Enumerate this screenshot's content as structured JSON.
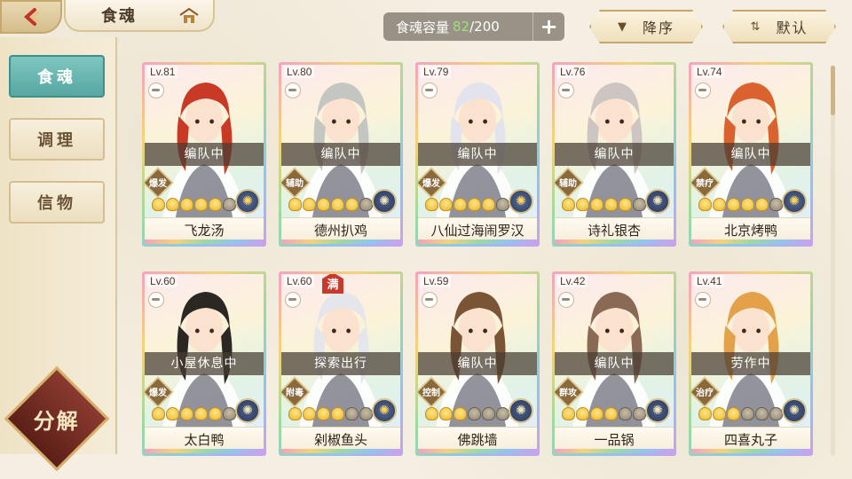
{
  "header": {
    "title": "食魂",
    "capacity_label": "食魂容量",
    "capacity_current": "82",
    "capacity_max": "/200",
    "plus_label": "+",
    "sort_order_label": "降序",
    "sort_mode_label": "默认"
  },
  "sidebar": {
    "items": [
      {
        "label": "食魂",
        "active": true
      },
      {
        "label": "调理",
        "active": false
      },
      {
        "label": "信物",
        "active": false
      }
    ],
    "decompose_label": "分解"
  },
  "cards": [
    {
      "lv": "Lv.81",
      "status": "编队中",
      "role": "爆发",
      "stars": 5,
      "name": "飞龙汤",
      "hair": "#c83a26",
      "element_gold": true,
      "full": false
    },
    {
      "lv": "Lv.80",
      "status": "编队中",
      "role": "辅助",
      "stars": 5,
      "name": "德州扒鸡",
      "hair": "#c4c6c2",
      "element_gold": false,
      "full": false
    },
    {
      "lv": "Lv.79",
      "status": "编队中",
      "role": "爆发",
      "stars": 5,
      "name": "八仙过海闹罗汉",
      "hair": "#e2e3ec",
      "element_gold": true,
      "full": false
    },
    {
      "lv": "Lv.76",
      "status": "编队中",
      "role": "辅助",
      "stars": 5,
      "name": "诗礼银杏",
      "hair": "#cdc5c2",
      "element_gold": false,
      "full": false
    },
    {
      "lv": "Lv.74",
      "status": "编队中",
      "role": "禁疗",
      "stars": 5,
      "name": "北京烤鸭",
      "hair": "#d9622e",
      "element_gold": true,
      "full": false
    },
    {
      "lv": "Lv.60",
      "status": "小屋休息中",
      "role": "爆发",
      "stars": 5,
      "name": "太白鸭",
      "hair": "#2b2824",
      "element_gold": false,
      "full": false
    },
    {
      "lv": "Lv.60",
      "status": "探索出行",
      "role": "附毒",
      "stars": 4,
      "name": "剁椒鱼头",
      "hair": "#e4e6ec",
      "element_gold": true,
      "full": true,
      "full_label": "满"
    },
    {
      "lv": "Lv.59",
      "status": "编队中",
      "role": "控制",
      "stars": 3,
      "name": "佛跳墙",
      "hair": "#7a5535",
      "element_gold": false,
      "full": false
    },
    {
      "lv": "Lv.42",
      "status": "编队中",
      "role": "群攻",
      "stars": 4,
      "name": "一品锅",
      "hair": "#8a6a55",
      "element_gold": false,
      "full": false
    },
    {
      "lv": "Lv.41",
      "status": "劳作中",
      "role": "治疗",
      "stars": 3,
      "name": "四喜丸子",
      "hair": "#e3a24a",
      "element_gold": false,
      "full": false
    }
  ],
  "colors": {
    "accent_teal": "#57a7a3",
    "status_bar": "#463c32",
    "capacity_current": "#9fe07a"
  },
  "icons": {
    "back": "back-arrow-icon",
    "home": "home-icon",
    "sort_order": "triangle-down-icon",
    "sort_mode": "sort-icon"
  }
}
